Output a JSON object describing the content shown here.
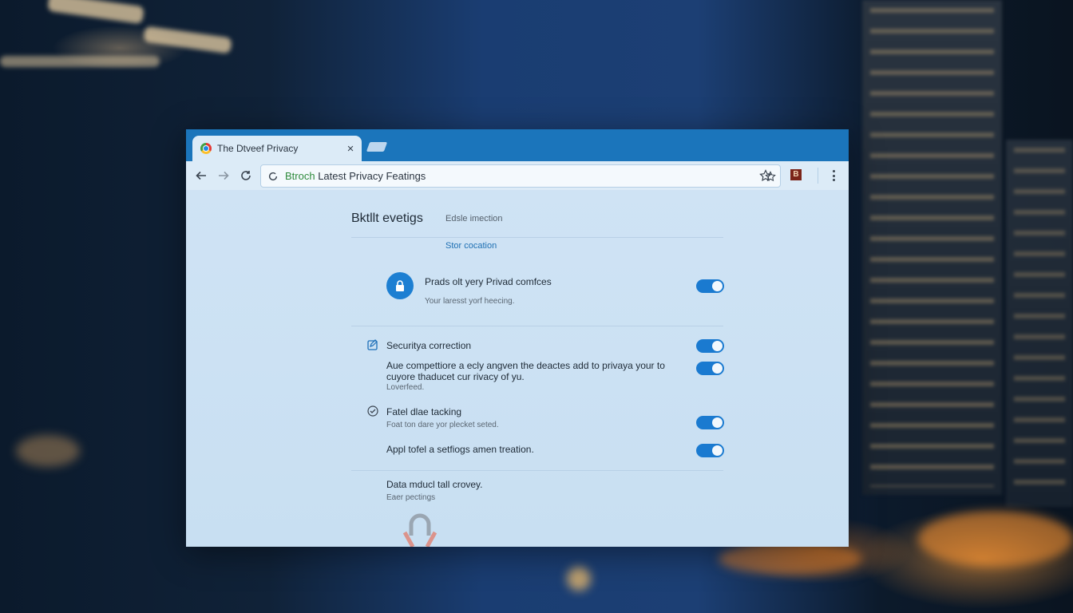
{
  "browser": {
    "tab": {
      "title": "The Dtveef Privacy",
      "close": "×"
    },
    "address_bar": {
      "highlight": "Btroch",
      "text": " Latest Privacy Featings"
    },
    "extension_badge": "B"
  },
  "settings": {
    "title": "Bktllt evetigs",
    "subtitle": "Edsle imection",
    "link": "Stor cocation",
    "rows": [
      {
        "title": "Prads olt yery Privad comfces",
        "subtitle": "Your laresst yorf heecing.",
        "toggle": true
      },
      {
        "title": "Securitya correction",
        "toggle": true
      },
      {
        "title_line1": "Aue compettiore a ecly angven the deactes add to privaya your to",
        "title_line2": "cuyore thaducet cur rivacy of yu.",
        "subtitle": "Loverfeed.",
        "toggle": true
      },
      {
        "title": "Fatel dlae tacking",
        "subtitle": "Foat ton dare yor plecket seted.",
        "toggle": true
      },
      {
        "title": "Appl tofel a setfiogs amen treation.",
        "toggle": true
      }
    ],
    "footer": {
      "title": "Data mducl tall crovey.",
      "subtitle": "Eaer pectings"
    }
  },
  "colors": {
    "tab_strip": "#1b75bb",
    "accent": "#1a7ad0",
    "page_bg": "#cfe3f4",
    "highlight_green": "#2e8a3c"
  },
  "icons": [
    "back-arrow-icon",
    "forward-arrow-icon",
    "reload-icon",
    "star-icon",
    "extension-icon",
    "menu-icon",
    "lock-icon",
    "edit-icon",
    "check-circle-icon"
  ]
}
